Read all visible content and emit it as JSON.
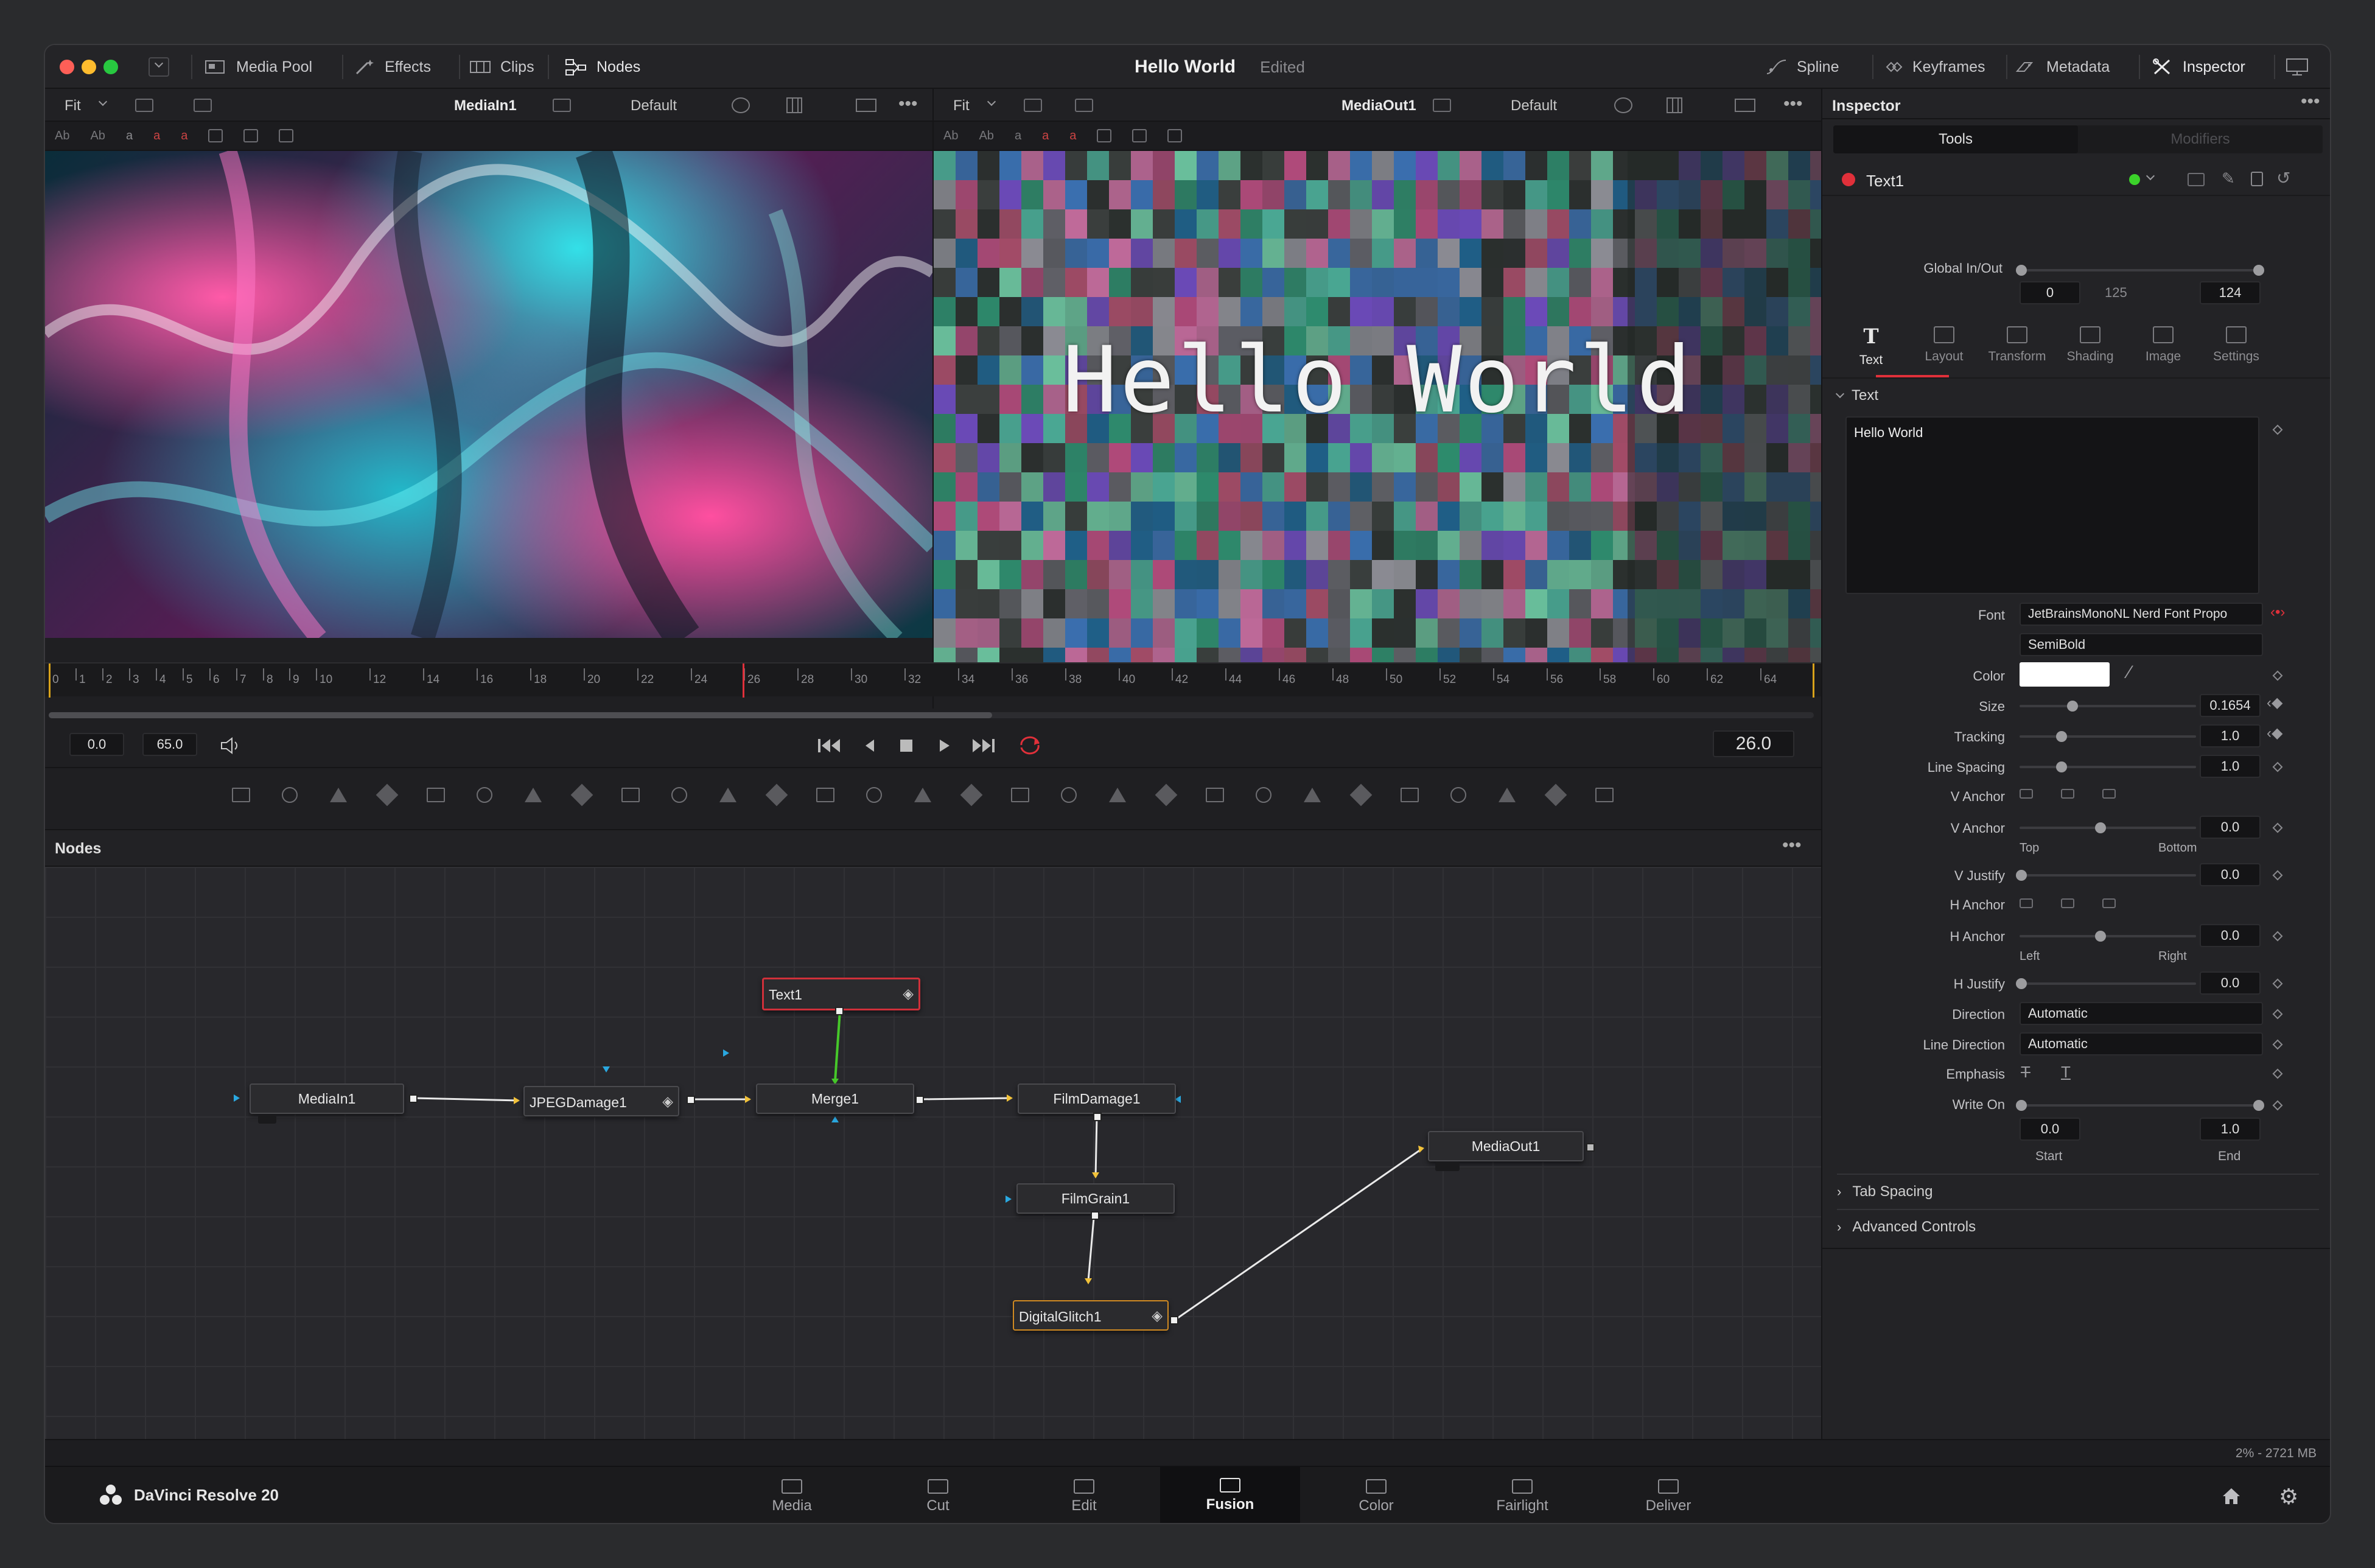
{
  "titlebar": {
    "title": "Hello World",
    "status": "Edited",
    "left_items": [
      "Media Pool",
      "Effects",
      "Clips",
      "Nodes"
    ],
    "right_items": [
      "Spline",
      "Keyframes",
      "Metadata",
      "Inspector"
    ]
  },
  "viewer_left": {
    "zoom": "Fit",
    "name": "MediaIn1",
    "preset": "Default"
  },
  "viewer_right": {
    "zoom": "Fit",
    "name": "MediaOut1",
    "preset": "Default",
    "overlay_text": "Hello World"
  },
  "timeline": {
    "ticks": [
      "0",
      "1",
      "2",
      "3",
      "4",
      "5",
      "6",
      "7",
      "8",
      "9",
      "10",
      "12",
      "14",
      "16",
      "18",
      "20",
      "22",
      "24",
      "26",
      "28",
      "30",
      "32",
      "34",
      "36",
      "38",
      "40",
      "42",
      "44",
      "46",
      "48",
      "50",
      "52",
      "54",
      "56",
      "58",
      "60",
      "62",
      "64"
    ],
    "start": "0.0",
    "end": "65.0",
    "current": "26.0"
  },
  "nodes_panel": {
    "title": "Nodes",
    "nodes": {
      "text1": "Text1",
      "mediain1": "MediaIn1",
      "jpegdamage1": "JPEGDamage1",
      "merge1": "Merge1",
      "filmdamage1": "FilmDamage1",
      "filmgrain1": "FilmGrain1",
      "digitalglitch1": "DigitalGlitch1",
      "mediaout1": "MediaOut1"
    }
  },
  "inspector": {
    "title": "Inspector",
    "tabs": [
      "Tools",
      "Modifiers"
    ],
    "tool_name": "Text1",
    "global_inout_label": "Global In/Out",
    "global_in": "0",
    "global_mid": "125",
    "global_out": "124",
    "subtabs": [
      "Text",
      "Layout",
      "Transform",
      "Shading",
      "Image",
      "Settings"
    ],
    "section_text": "Text",
    "styled_text": "Hello World",
    "labels": {
      "font": "Font",
      "color": "Color",
      "size": "Size",
      "tracking": "Tracking",
      "line_spacing": "Line Spacing",
      "v_anchor": "V Anchor",
      "v_anchor2": "V Anchor",
      "v_justify": "V Justify",
      "h_anchor": "H Anchor",
      "h_anchor2": "H Anchor",
      "h_justify": "H Justify",
      "direction": "Direction",
      "line_direction": "Line Direction",
      "emphasis": "Emphasis",
      "write_on": "Write On"
    },
    "values": {
      "font": "JetBrainsMonoNL Nerd Font Propo",
      "font_style": "SemiBold",
      "size": "0.1654",
      "tracking": "1.0",
      "line_spacing": "1.0",
      "v_anchor": "0.0",
      "v_anchor_left": "Top",
      "v_anchor_right": "Bottom",
      "v_justify": "0.0",
      "h_anchor": "0.0",
      "h_anchor_left": "Left",
      "h_anchor_right": "Right",
      "h_justify": "0.0",
      "direction": "Automatic",
      "line_direction": "Automatic",
      "write_on_start": "0.0",
      "write_on_end": "1.0",
      "start_label": "Start",
      "end_label": "End"
    },
    "collapsed": [
      "Tab Spacing",
      "Advanced Controls"
    ],
    "memory": "2% - 2721 MB"
  },
  "pagebar": {
    "app": "DaVinci Resolve 20",
    "pages": [
      "Media",
      "Cut",
      "Edit",
      "Fusion",
      "Color",
      "Fairlight",
      "Deliver"
    ],
    "active": "Fusion"
  },
  "colors": {
    "accent_red": "#e0303a",
    "active_page_line": "#e0303a",
    "text_node_border": "#d0303a"
  }
}
